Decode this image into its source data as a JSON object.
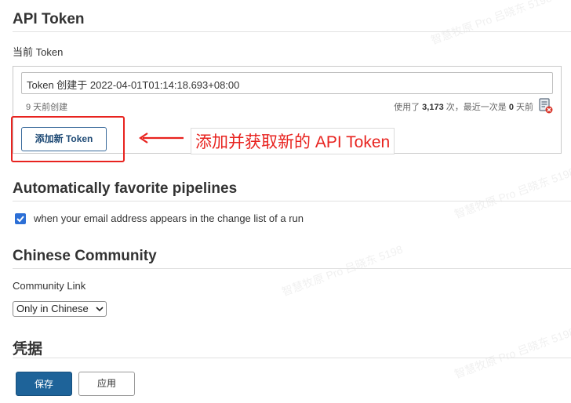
{
  "api_token": {
    "title": "API Token",
    "current_token_label": "当前 Token",
    "token_field_value": "Token 创建于 2022-04-01T01:14:18.693+08:00",
    "created_ago": "9 天前创建",
    "usage_prefix": "使用了 ",
    "usage_count": "3,173",
    "usage_middle": " 次，最近一次是 ",
    "last_used": "0",
    "usage_suffix": " 天前",
    "add_token_button": "添加新 Token",
    "annotation": "添加并获取新的 API Token"
  },
  "auto_favorite": {
    "title": "Automatically favorite pipelines",
    "checkbox_label": "when your email address appears in the change list of a run",
    "checked": true
  },
  "chinese_community": {
    "title": "Chinese Community",
    "link_label": "Community Link",
    "select_value": "Only in Chinese"
  },
  "credentials": {
    "title": "凭据"
  },
  "actions": {
    "save": "保存",
    "apply": "应用"
  },
  "watermark": "智慧牧原 Pro 吕晓东 5198",
  "colors": {
    "accent": "#1e6399",
    "annotation_red": "#e8231f",
    "checkbox_blue": "#2c6fd6"
  }
}
